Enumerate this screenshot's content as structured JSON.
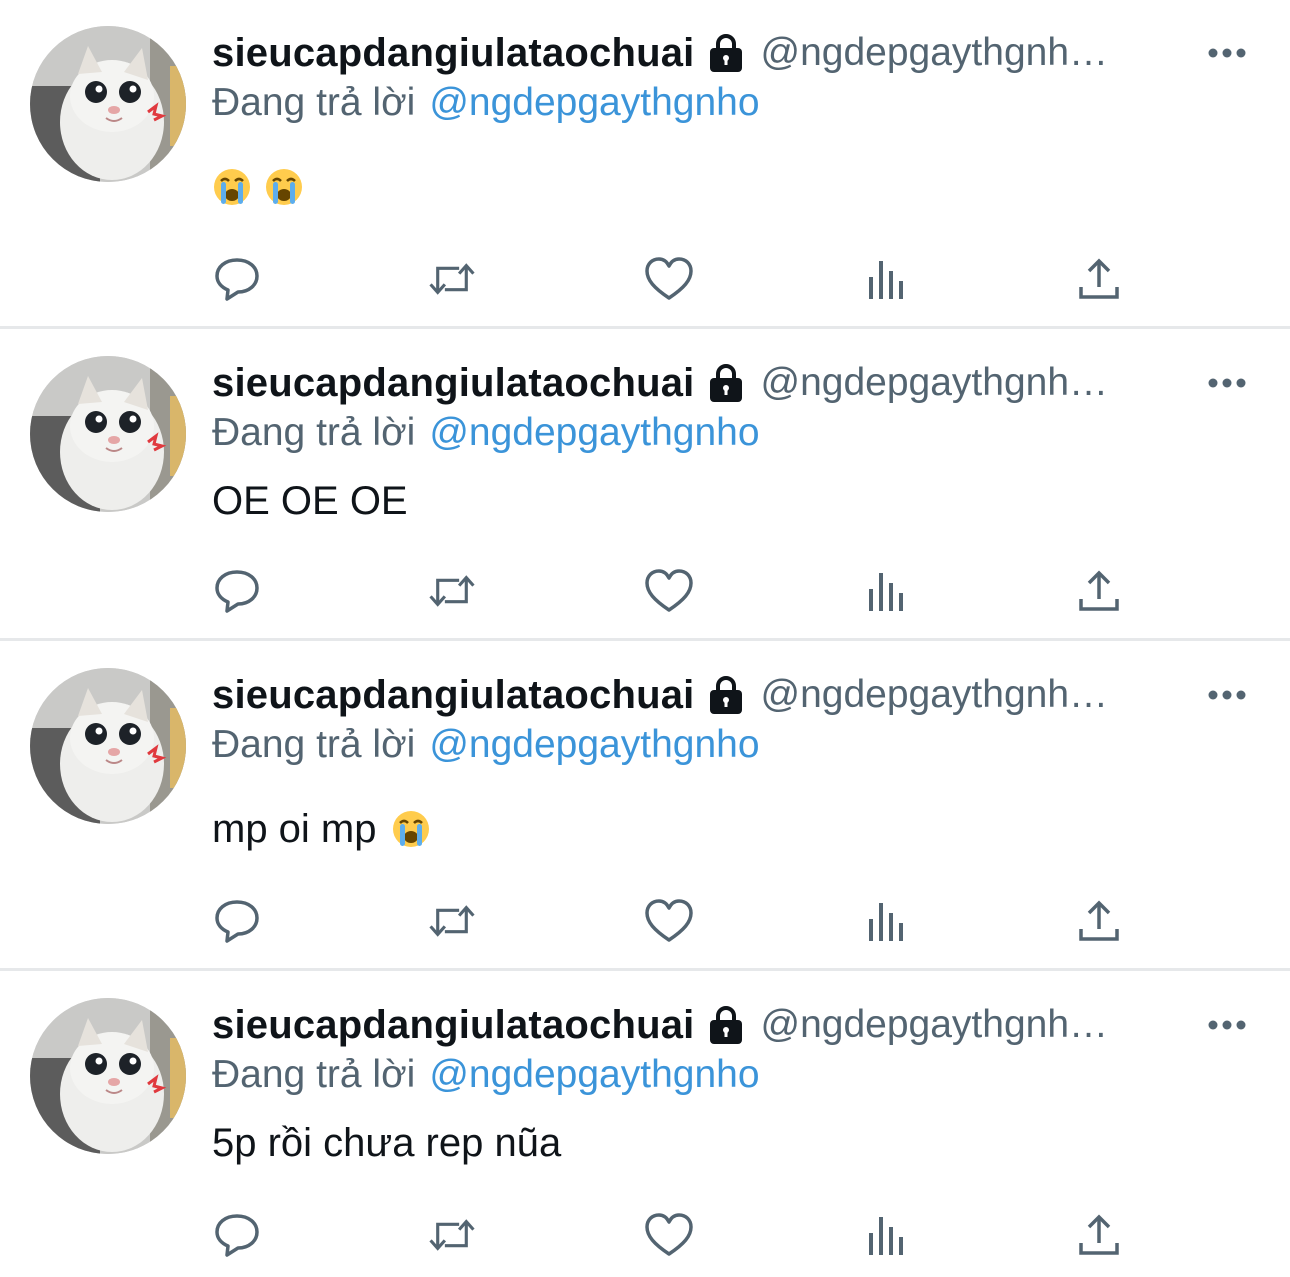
{
  "colors": {
    "text_primary": "#0f1419",
    "text_secondary": "#536471",
    "mention": "#3b94d9",
    "divider": "#e6e8ea",
    "icon": "#536471"
  },
  "tweets": [
    {
      "display_name": "sieucapdangiulataochuai",
      "handle": "@ngdepgaythgnh…",
      "reply_prefix": "Đang trả lời",
      "reply_to": "@ngdepgaythgnho",
      "text": "",
      "emojis": [
        "loudly-crying-face",
        "loudly-crying-face"
      ]
    },
    {
      "display_name": "sieucapdangiulataochuai",
      "handle": "@ngdepgaythgnh…",
      "reply_prefix": "Đang trả lời",
      "reply_to": "@ngdepgaythgnho",
      "text": "OE OE OE",
      "emojis": []
    },
    {
      "display_name": "sieucapdangiulataochuai",
      "handle": "@ngdepgaythgnh…",
      "reply_prefix": "Đang trả lời",
      "reply_to": "@ngdepgaythgnho",
      "text": "mp oi mp",
      "emojis": [
        "loudly-crying-face"
      ]
    },
    {
      "display_name": "sieucapdangiulataochuai",
      "handle": "@ngdepgaythgnh…",
      "reply_prefix": "Đang trả lời",
      "reply_to": "@ngdepgaythgnho",
      "text": "5p rồi chưa rep nũa",
      "emojis": []
    }
  ],
  "icons": {
    "lock": "lock-icon",
    "more": "more-icon",
    "reply": "reply-icon",
    "retweet": "retweet-icon",
    "like": "like-icon",
    "views": "views-icon",
    "share": "share-icon",
    "emoji": "loudly-crying-face-emoji"
  }
}
